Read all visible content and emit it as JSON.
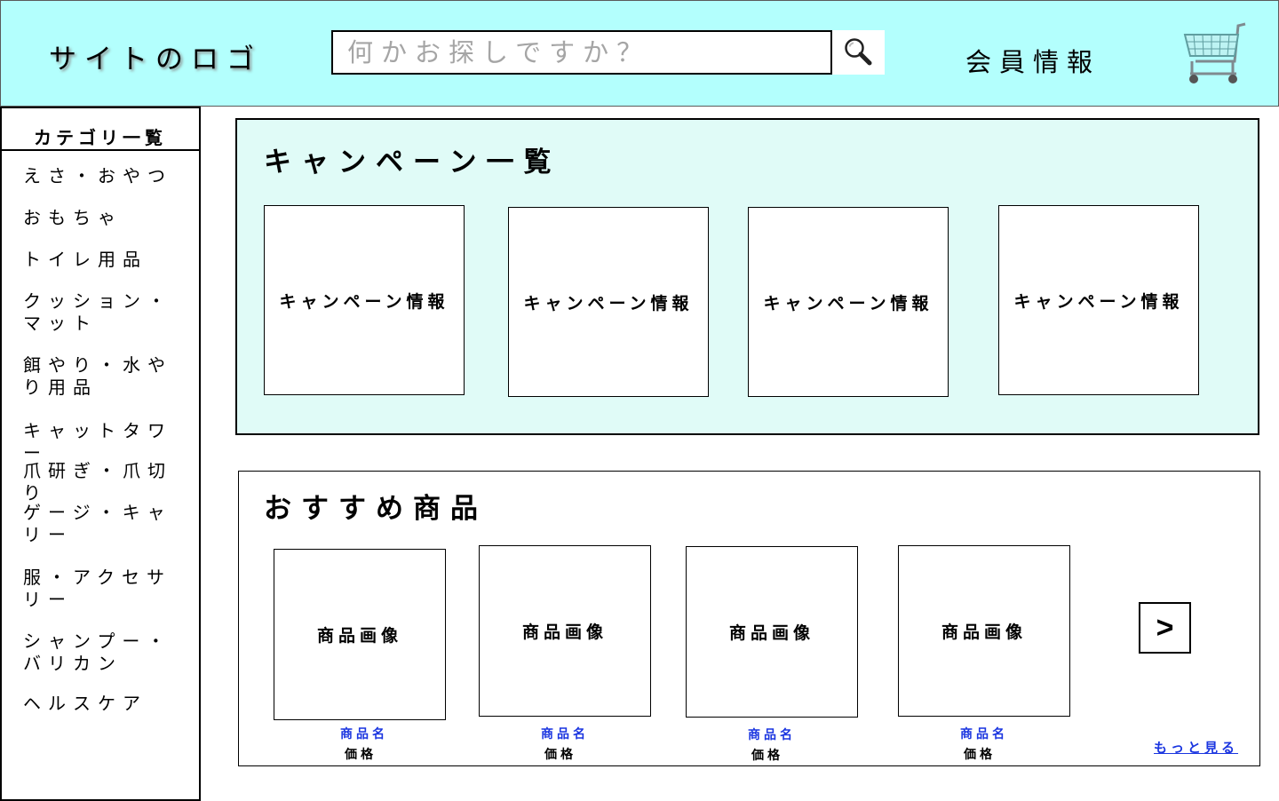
{
  "header": {
    "logo": "サイトのロゴ",
    "search_placeholder": "何かお探しですか？",
    "member_label": "会員情報",
    "search_icon": "magnifier-icon",
    "cart_icon": "shopping-cart-icon",
    "background_color": "#b3fffd"
  },
  "sidebar": {
    "title": "カテゴリ一覧",
    "items": [
      {
        "label": "えさ・おやつ"
      },
      {
        "label": "おもちゃ"
      },
      {
        "label": "トイレ用品"
      },
      {
        "label": "クッション・マット"
      },
      {
        "label": "餌やり・水やり用品"
      },
      {
        "label": "キャットタワー"
      },
      {
        "label": "爪研ぎ・爪切り"
      },
      {
        "label": "ゲージ・キャリー"
      },
      {
        "label": "服・アクセサリー"
      },
      {
        "label": "シャンプー・バリカン"
      },
      {
        "label": "ヘルスケア"
      }
    ]
  },
  "campaign": {
    "title": "キャンペーン一覧",
    "background_color": "#e0fbf7",
    "cards": [
      {
        "label": "キャンペーン情報"
      },
      {
        "label": "キャンペーン情報"
      },
      {
        "label": "キャンペーン情報"
      },
      {
        "label": "キャンペーン情報"
      }
    ]
  },
  "recommend": {
    "title": "おすすめ商品",
    "products": [
      {
        "image_label": "商品画像",
        "name": "商品名",
        "price": "価格"
      },
      {
        "image_label": "商品画像",
        "name": "商品名",
        "price": "価格"
      },
      {
        "image_label": "商品画像",
        "name": "商品名",
        "price": "価格"
      },
      {
        "image_label": "商品画像",
        "name": "商品名",
        "price": "価格"
      }
    ],
    "next_label": ">",
    "more_label": "もっと見る",
    "link_color": "#1a35e0"
  }
}
